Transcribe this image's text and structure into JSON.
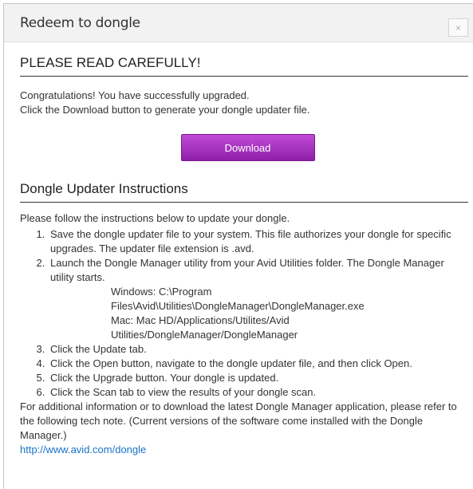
{
  "dialog": {
    "title": "Redeem to dongle",
    "close_label": "×"
  },
  "notice": {
    "heading": "PLEASE READ CAREFULLY!",
    "line1": "Congratulations! You have successfully upgraded.",
    "line2": "Click the Download button to generate your dongle updater file.",
    "download_label": "Download"
  },
  "instructions": {
    "heading": "Dongle Updater Instructions",
    "intro": "Please follow the instructions below to update your dongle.",
    "steps": [
      "Save the dongle updater file to your system. This file authorizes your dongle for specific upgrades. The updater file extension is .avd.",
      "Launch the Dongle Manager utility from your Avid Utilities folder. The Dongle Manager utility starts.",
      "Click the Update tab.",
      "Click the Open button, navigate to the dongle updater file, and then click Open.",
      "Click the Upgrade button. Your dongle is updated.",
      "Click the Scan tab to view the results of your dongle scan."
    ],
    "paths": [
      "Windows: C:\\Program",
      "Files\\Avid\\Utilities\\DongleManager\\DongleManager.exe",
      "Mac: Mac HD/Applications/Utilites/Avid",
      "Utilities/DongleManager/DongleManager"
    ],
    "footer": "For additional information or to download the latest Dongle Manager application, please refer to the following tech note. (Current versions of the software come installed with the Dongle Manager.)",
    "link": "http://www.avid.com/dongle"
  }
}
